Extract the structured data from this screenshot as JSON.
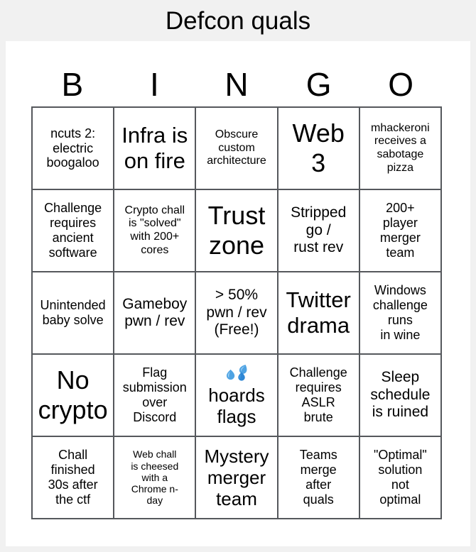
{
  "title": "Defcon quals",
  "header": {
    "letters": [
      "B",
      "I",
      "N",
      "G",
      "O"
    ]
  },
  "icons": {
    "droplets": "sweat-droplets-icon",
    "droplets_colors": [
      "#9fd2f5",
      "#4fa3e3",
      "#2e86d4"
    ]
  },
  "grid": {
    "rows": 5,
    "columns": 5,
    "cells": [
      {
        "text": "ncuts 2:\nelectric\nboogaloo",
        "size": "m"
      },
      {
        "text": "Infra is\non fire",
        "size": "xxl"
      },
      {
        "text": "Obscure\ncustom\narchitecture",
        "size": "s"
      },
      {
        "text": "Web\n3",
        "size": "h"
      },
      {
        "text": "mhackeroni\nreceives a\nsabotage\npizza",
        "size": "s"
      },
      {
        "text": "Challenge\nrequires\nancient\nsoftware",
        "size": "m"
      },
      {
        "text": "Crypto chall\nis \"solved\"\nwith 200+\ncores",
        "size": "s"
      },
      {
        "text": "Trust\nzone",
        "size": "h"
      },
      {
        "text": "Stripped\ngo /\nrust rev",
        "size": "l"
      },
      {
        "text": "200+\nplayer\nmerger\nteam",
        "size": "m"
      },
      {
        "text": "Unintended\nbaby solve",
        "size": "m"
      },
      {
        "text": "Gameboy\npwn / rev",
        "size": "l"
      },
      {
        "text": "> 50%\npwn / rev\n(Free!)",
        "size": "l"
      },
      {
        "text": "Twitter\ndrama",
        "size": "xxl"
      },
      {
        "text": "Windows\nchallenge\nruns\nin wine",
        "size": "m"
      },
      {
        "text": "No\ncrypto",
        "size": "h"
      },
      {
        "text": "Flag\nsubmission\nover\nDiscord",
        "size": "m"
      },
      {
        "text": "hoards\nflags",
        "size": "xl",
        "icon": "droplets"
      },
      {
        "text": "Challenge\nrequires\nASLR\nbrute",
        "size": "m"
      },
      {
        "text": "Sleep\nschedule\nis ruined",
        "size": "l"
      },
      {
        "text": "Chall\nfinished\n30s after\nthe ctf",
        "size": "m"
      },
      {
        "text": "Web chall\nis cheesed\nwith a\nChrome n-\nday",
        "size": "xs"
      },
      {
        "text": "Mystery\nmerger\nteam",
        "size": "xl"
      },
      {
        "text": "Teams\nmerge\nafter\nquals",
        "size": "m"
      },
      {
        "text": "\"Optimal\"\nsolution\nnot\noptimal",
        "size": "m"
      }
    ]
  }
}
